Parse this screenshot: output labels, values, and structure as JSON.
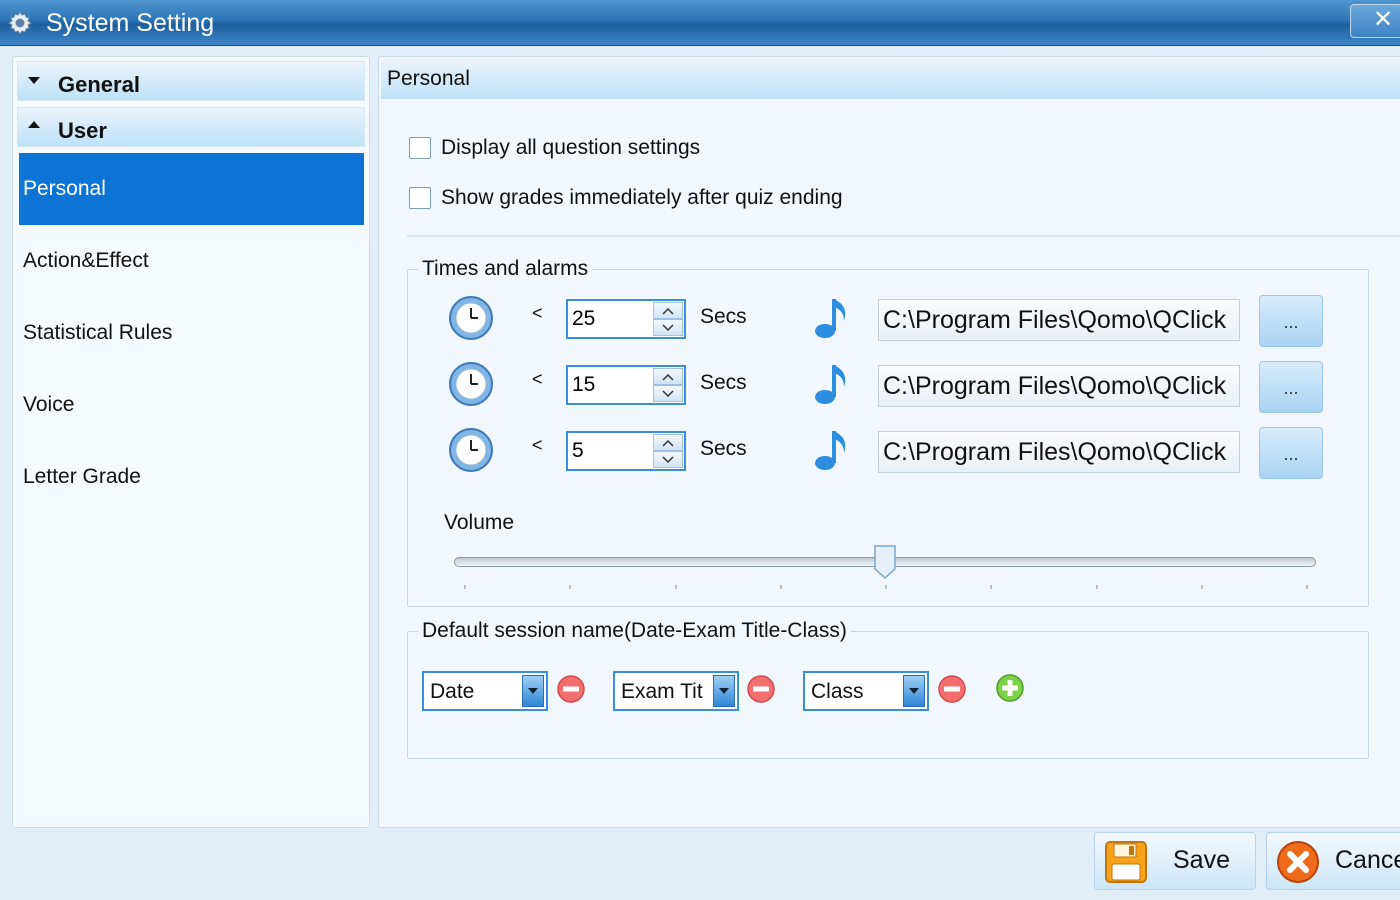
{
  "window": {
    "title": "System Setting",
    "close_label": "✕"
  },
  "sidebar": {
    "groups": [
      {
        "label": "General",
        "expanded": false
      },
      {
        "label": "User",
        "expanded": true
      }
    ],
    "items": [
      {
        "label": "Personal",
        "active": true
      },
      {
        "label": "Action&Effect",
        "active": false
      },
      {
        "label": "Statistical Rules",
        "active": false
      },
      {
        "label": "Voice",
        "active": false
      },
      {
        "label": "Letter Grade",
        "active": false
      }
    ]
  },
  "panel": {
    "title": "Personal",
    "options": [
      {
        "label": "Display all question settings",
        "checked": false
      },
      {
        "label": "Show grades immediately after quiz ending",
        "checked": false
      }
    ],
    "times": {
      "legend": "Times and alarms",
      "less_than": "<",
      "unit": "Secs",
      "browse_label": "...",
      "rows": [
        {
          "seconds": "25",
          "path": "C:\\Program Files\\Qomo\\QClick"
        },
        {
          "seconds": "15",
          "path": "C:\\Program Files\\Qomo\\QClick"
        },
        {
          "seconds": "5",
          "path": "C:\\Program Files\\Qomo\\QClick"
        }
      ],
      "volume_label": "Volume",
      "volume_fraction": 0.5
    },
    "session": {
      "legend": "Default session name(Date-Exam Title-Class)",
      "fields": [
        "Date",
        "Exam Tit",
        "Class"
      ]
    }
  },
  "footer": {
    "save_label": "Save",
    "cancel_label": "Cancel"
  },
  "colors": {
    "accent": "#0b74d4",
    "titlebar": "#2d74b6",
    "panel_bg": "#f1f7fc"
  }
}
